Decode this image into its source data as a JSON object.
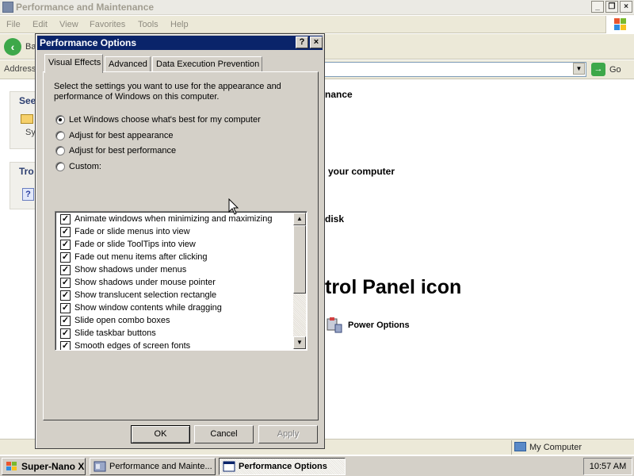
{
  "explorer": {
    "title": "Performance and Maintenance",
    "menu": [
      "File",
      "Edit",
      "View",
      "Favorites",
      "Tools",
      "Help"
    ],
    "back_label": "Ba",
    "address_label": "Address",
    "go_label": "Go",
    "see_also_fragment": "See",
    "sys_fragment": "Sy",
    "troubleshooters_fragment": "Tro",
    "fragments": {
      "maintenance": "nance",
      "your_computer": "your computer",
      "disk": "disk",
      "control_panel_icon": "trol Panel icon",
      "power_options": "Power Options"
    },
    "status_my_computer": "My Computer"
  },
  "dialog": {
    "title": "Performance Options",
    "tabs": [
      "Visual Effects",
      "Advanced",
      "Data Execution Prevention"
    ],
    "active_tab": "Visual Effects",
    "description": "Select the settings you want to use for the appearance and performance of Windows on this computer.",
    "options": [
      {
        "label": "Let Windows choose what's best for my computer",
        "selected": true
      },
      {
        "label": "Adjust for best appearance",
        "selected": false
      },
      {
        "label": "Adjust for best performance",
        "selected": false
      },
      {
        "label": "Custom:",
        "selected": false
      }
    ],
    "effects": [
      {
        "label": "Animate windows when minimizing and maximizing",
        "checked": true
      },
      {
        "label": "Fade or slide menus into view",
        "checked": true
      },
      {
        "label": "Fade or slide ToolTips into view",
        "checked": true
      },
      {
        "label": "Fade out menu items after clicking",
        "checked": true
      },
      {
        "label": "Show shadows under menus",
        "checked": true
      },
      {
        "label": "Show shadows under mouse pointer",
        "checked": true
      },
      {
        "label": "Show translucent selection rectangle",
        "checked": true
      },
      {
        "label": "Show window contents while dragging",
        "checked": true
      },
      {
        "label": "Slide open combo boxes",
        "checked": true
      },
      {
        "label": "Slide taskbar buttons",
        "checked": true
      },
      {
        "label": "Smooth edges of screen fonts",
        "checked": true
      }
    ],
    "buttons": {
      "ok": "OK",
      "cancel": "Cancel",
      "apply": "Apply"
    },
    "help_glyph": "?",
    "close_glyph": "×"
  },
  "taskbar": {
    "start": "Super-Nano XP",
    "items": [
      "Performance and Mainte...",
      "Performance Options"
    ],
    "active_item": "Performance Options",
    "clock": "10:57 AM"
  },
  "colors": {
    "title_active": "#0a246a",
    "face": "#d4d0c8",
    "explorer_inactive_title": "#ebeae4"
  }
}
